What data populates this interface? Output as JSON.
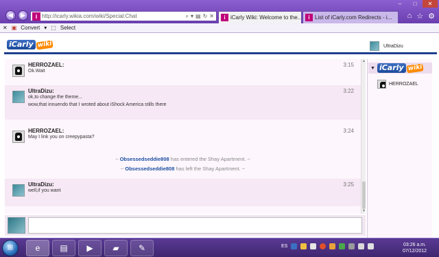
{
  "browser": {
    "address_url": "http://icarly.wikia.com/wiki/Special:Chat",
    "tabs": [
      {
        "title": "iCarly Wiki: Welcome to the...",
        "close": "×"
      },
      {
        "title": "List of iCarly.com Redirects - i...",
        "close": ""
      }
    ],
    "favicon_glyph": "i",
    "window_controls": [
      "–",
      "□",
      "✕"
    ],
    "toolbar_icons": [
      "home-icon",
      "favorites-star-icon",
      "tools-gear-icon"
    ]
  },
  "command_bar": {
    "close_label": "✕",
    "convert_label": "Convert",
    "select_label": "Select"
  },
  "header": {
    "logo_text": "iCarly",
    "logo_wiki": "wiki",
    "current_user": "UltraDizu"
  },
  "chat": {
    "messages": [
      {
        "user": "HERROZAEL:",
        "time": "3:15",
        "lines": [
          "Ok.Wait"
        ]
      },
      {
        "user": "UltraDizu:",
        "time": "3:22",
        "lines": [
          "ok,to change the theme...",
          "wow,that innuendo that I wroted about iShock America stills there"
        ]
      },
      {
        "user": "HERROZAEL:",
        "time": "3:24",
        "lines": [
          "May I link you on creepypasta?"
        ]
      },
      {
        "user": "UltraDizu:",
        "time": "3:25",
        "lines": [
          "well,if you want"
        ]
      }
    ],
    "system": [
      {
        "prefix": "~ ",
        "user": "Obsessedseddie808",
        "text": " has entered the Shay Apartment. ~"
      },
      {
        "prefix": "~ ",
        "user": "Obsessedseddie808",
        "text": " has left the Shay Apartment. ~"
      }
    ],
    "input_value": ""
  },
  "sidebar": {
    "room_logo_text": "iCarly",
    "room_logo_wiki": "wiki",
    "users": [
      "HERROZAEL"
    ]
  },
  "taskbar": {
    "language": "ES",
    "time": "03:26 a.m.",
    "date": "07/12/2012",
    "apps": [
      "internet-explorer",
      "file-explorer",
      "media-player",
      "folder",
      "paint"
    ]
  }
}
